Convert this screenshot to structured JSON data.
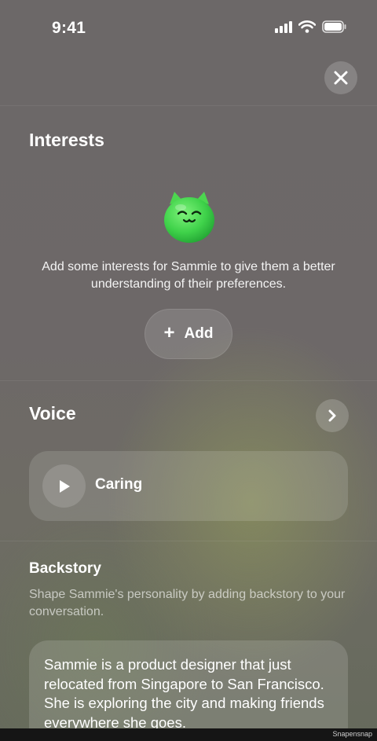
{
  "status_bar": {
    "time": "9:41"
  },
  "interests": {
    "title": "Interests",
    "description": "Add some interests for Sammie to give them a better understanding of their preferences.",
    "add_button_label": "Add"
  },
  "voice": {
    "title": "Voice",
    "selected_voice": "Caring"
  },
  "backstory": {
    "title": "Backstory",
    "description": "Shape Sammie's personality by adding backstory to your conversation.",
    "text": "Sammie is a product designer that just relocated from Singapore to San Francisco. She is exploring the city and making friends everywhere she goes."
  },
  "watermark": "Snapensnap",
  "colors": {
    "mascot_green": "#3fd24a",
    "background": "#6c6868"
  }
}
